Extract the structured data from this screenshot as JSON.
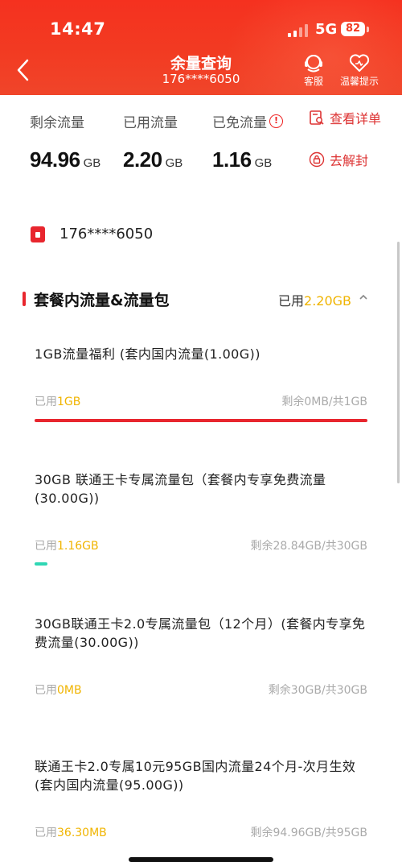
{
  "status_bar": {
    "time": "14:47",
    "network": "5G",
    "battery": "82"
  },
  "header": {
    "title": "余量查询",
    "phone": "176****6050",
    "service_label": "客服",
    "tips_label": "温馨提示"
  },
  "summary": {
    "remaining_label": "剩余流量",
    "remaining_value": "94.96",
    "remaining_unit": "GB",
    "used_label": "已用流量",
    "used_value": "2.20",
    "used_unit": "GB",
    "free_label": "已免流量",
    "free_value": "1.16",
    "free_unit": "GB",
    "detail_link": "查看详单",
    "unlock_link": "去解封"
  },
  "account": {
    "phone": "176****6050"
  },
  "section": {
    "title": "套餐内流量&流量包",
    "used_prefix": "已用",
    "used_amount": "2.20GB"
  },
  "packages": [
    {
      "name": "1GB流量福利 (套内国内流量(1.00G))",
      "used_prefix": "已用",
      "used_amount": "1GB",
      "remain_text": "剩余0MB/共1GB",
      "used_fraction": 1.0,
      "bar_color": "#e8262e"
    },
    {
      "name": "30GB 联通王卡专属流量包（套餐内专享免费流量(30.00G))",
      "used_prefix": "已用",
      "used_amount": "1.16GB",
      "remain_text": "剩余28.84GB/共30GB",
      "used_fraction": 0.039,
      "bar_color": "#2fd7b4"
    },
    {
      "name": "30GB联通王卡2.0专属流量包（12个月）(套餐内专享免费流量(30.00G))",
      "used_prefix": "已用",
      "used_amount": "0MB",
      "remain_text": "剩余30GB/共30GB",
      "used_fraction": 0,
      "bar_color": "#2fd7b4"
    },
    {
      "name": "联通王卡2.0专属10元95GB国内流量24个月-次月生效 (套内国内流量(95.00G))",
      "used_prefix": "已用",
      "used_amount": "36.30MB",
      "remain_text": "剩余94.96GB/共95GB",
      "used_fraction": 0.0004,
      "bar_color": "#2fd7b4"
    }
  ]
}
